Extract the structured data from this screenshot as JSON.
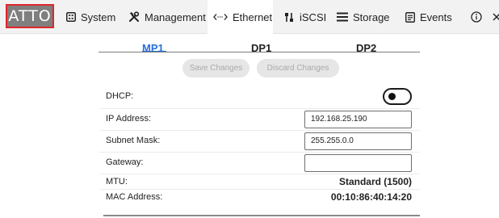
{
  "logo": {
    "text": "ATTO"
  },
  "nav": {
    "items": [
      {
        "label": "System",
        "icon": "system-icon"
      },
      {
        "label": "Management",
        "icon": "tools-icon"
      },
      {
        "label": "Ethernet",
        "icon": "ethernet-icon",
        "active": true
      },
      {
        "label": "iSCSI",
        "icon": "iscsi-icon"
      },
      {
        "label": "Storage",
        "icon": "storage-icon"
      },
      {
        "label": "Events",
        "icon": "events-icon"
      }
    ],
    "info_icon": "info-icon",
    "close_icon": "close-icon"
  },
  "tabs": [
    {
      "label": "MP1",
      "active": true
    },
    {
      "label": "DP1"
    },
    {
      "label": "DP2"
    }
  ],
  "buttons": {
    "save": "Save Changes",
    "discard": "Discard Changes"
  },
  "form": {
    "dhcp": {
      "label": "DHCP:",
      "enabled": true
    },
    "ip": {
      "label": "IP Address:",
      "value": "192.168.25.190"
    },
    "subnet": {
      "label": "Subnet Mask:",
      "value": "255.255.0.0"
    },
    "gateway": {
      "label": "Gateway:",
      "value": ""
    },
    "mtu": {
      "label": "MTU:",
      "value": "Standard (1500)"
    },
    "mac": {
      "label": "MAC Address:",
      "value": "00:10:86:40:14:20"
    }
  },
  "colors": {
    "accent": "#2a6fdb",
    "logo_bg": "#7f7f7f",
    "logo_border": "#e0262b",
    "topbar_bg": "#f2f2f2"
  }
}
